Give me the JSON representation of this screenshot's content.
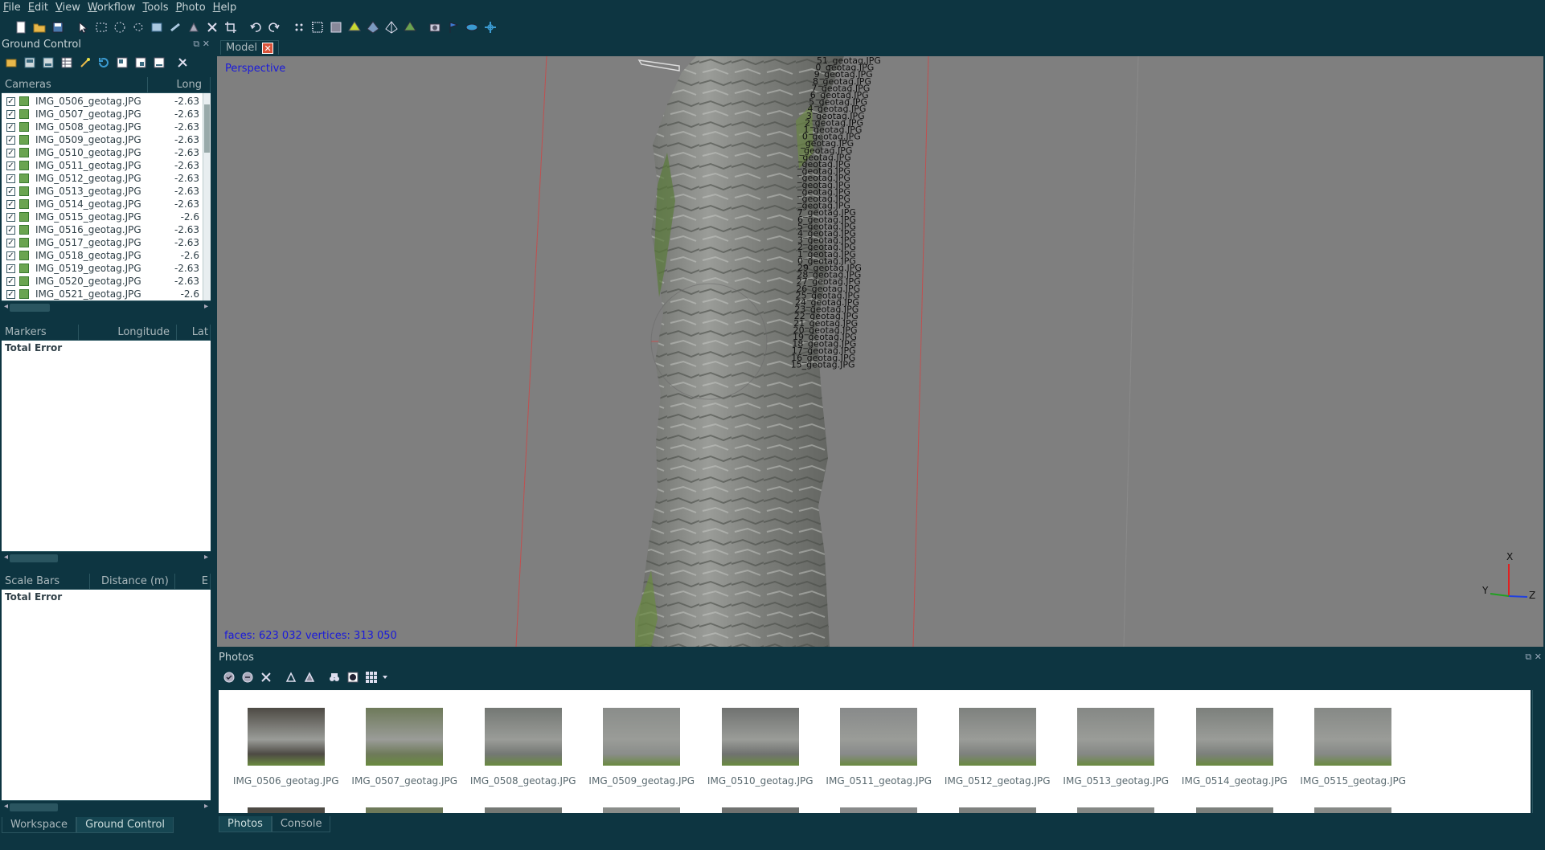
{
  "menu": [
    "File",
    "Edit",
    "View",
    "Workflow",
    "Tools",
    "Photo",
    "Help"
  ],
  "toolbar_icons": [
    "new-icon",
    "open-icon",
    "save-icon",
    "pointer-icon",
    "rect-select-icon",
    "circle-select-icon",
    "free-select-icon",
    "move-region-icon",
    "rotate-region-icon",
    "resize-region-icon",
    "delete-selection-icon",
    "crop-icon",
    "undo-icon",
    "redo-icon",
    "point-cloud-icon",
    "dense-cloud-icon",
    "tiled-icon",
    "shaded-icon",
    "solid-icon",
    "wireframe-icon",
    "textured-icon",
    "show-cameras-icon",
    "show-markers-icon",
    "show-shapes-icon",
    "navigation-icon"
  ],
  "left": {
    "title": "Ground Control",
    "cameras": {
      "headers": [
        "Cameras",
        "Long"
      ],
      "rows": [
        {
          "name": "IMG_0506_geotag.JPG",
          "lon": "-2.63"
        },
        {
          "name": "IMG_0507_geotag.JPG",
          "lon": "-2.63"
        },
        {
          "name": "IMG_0508_geotag.JPG",
          "lon": "-2.63"
        },
        {
          "name": "IMG_0509_geotag.JPG",
          "lon": "-2.63"
        },
        {
          "name": "IMG_0510_geotag.JPG",
          "lon": "-2.63"
        },
        {
          "name": "IMG_0511_geotag.JPG",
          "lon": "-2.63"
        },
        {
          "name": "IMG_0512_geotag.JPG",
          "lon": "-2.63"
        },
        {
          "name": "IMG_0513_geotag.JPG",
          "lon": "-2.63"
        },
        {
          "name": "IMG_0514_geotag.JPG",
          "lon": "-2.63"
        },
        {
          "name": "IMG_0515_geotag.JPG",
          "lon": "-2.6"
        },
        {
          "name": "IMG_0516_geotag.JPG",
          "lon": "-2.63"
        },
        {
          "name": "IMG_0517_geotag.JPG",
          "lon": "-2.63"
        },
        {
          "name": "IMG_0518_geotag.JPG",
          "lon": "-2.6"
        },
        {
          "name": "IMG_0519_geotag.JPG",
          "lon": "-2.63"
        },
        {
          "name": "IMG_0520_geotag.JPG",
          "lon": "-2.63"
        },
        {
          "name": "IMG_0521_geotag.JPG",
          "lon": "-2.6"
        }
      ]
    },
    "markers": {
      "headers": [
        "Markers",
        "Longitude",
        "Lat"
      ],
      "total": "Total Error"
    },
    "scalebars": {
      "headers": [
        "Scale Bars",
        "Distance (m)",
        "E"
      ],
      "total": "Total Error"
    },
    "tabs": [
      "Workspace",
      "Ground Control"
    ]
  },
  "model": {
    "tab": "Model",
    "view_mode": "Perspective",
    "stats": "faces: 623 032 vertices: 313 050",
    "axes": {
      "x": "X",
      "y": "Y",
      "z": "Z"
    },
    "overlay_labels": [
      "51_geotag.JPG",
      "0_geotag.JPG",
      "9_geotag.JPG",
      "8_geotag.JPG",
      "7_geotag.JPG",
      "6_geotag.JPG",
      "5_geotag.JPG",
      "4_geotag.JPG",
      "3_geotag.JPG",
      "2_geotag.JPG",
      "1_geotag.JPG",
      "0_geotag.JPG",
      "_geotag.JPG",
      "_geotag.JPG",
      "_geotag.JPG",
      "_geotag.JPG",
      "_geotag.JPG",
      "_geotag.JPG",
      "_geotag.JPG",
      "_geotag.JPG",
      "_geotag.JPG",
      "_geotag.JPG",
      "7_geotag.JPG",
      "6_geotag.JPG",
      "5_geotag.JPG",
      "4_geotag.JPG",
      "3_geotag.JPG",
      "2_geotag.JPG",
      "1_geotag.JPG",
      "0_geotag.JPG",
      "29_geotag.JPG",
      "28_geotag.JPG",
      "27_geotag.JPG",
      "26_geotag.JPG",
      "25_geotag.JPG",
      "24_geotag.JPG",
      "23_geotag.JPG",
      "22_geotag.JPG",
      "21_geotag.JPG",
      "20_geotag.JPG",
      "19_geotag.JPG",
      "18_geotag.JPG",
      "17_geotag.JPG",
      "16_geotag.JPG",
      "15_geotag.JPG"
    ]
  },
  "photos": {
    "title": "Photos",
    "toolbar_icons": [
      "enable-icon",
      "disable-icon",
      "remove-icon",
      "rotate-right-icon",
      "rotate-left-icon",
      "binoculars-icon",
      "mask-icon",
      "view-mode-icon"
    ],
    "items": [
      {
        "label": "IMG_0506_geotag.JPG",
        "color": "#4d4a44"
      },
      {
        "label": "IMG_0507_geotag.JPG",
        "color": "#6e7a5a"
      },
      {
        "label": "IMG_0508_geotag.JPG",
        "color": "#747874"
      },
      {
        "label": "IMG_0509_geotag.JPG",
        "color": "#8a8d8a"
      },
      {
        "label": "IMG_0510_geotag.JPG",
        "color": "#707270"
      },
      {
        "label": "IMG_0511_geotag.JPG",
        "color": "#888a8a"
      },
      {
        "label": "IMG_0512_geotag.JPG",
        "color": "#7e817e"
      },
      {
        "label": "IMG_0513_geotag.JPG",
        "color": "#858885"
      },
      {
        "label": "IMG_0514_geotag.JPG",
        "color": "#7c807c"
      },
      {
        "label": "IMG_0515_geotag.JPG",
        "color": "#868986"
      }
    ],
    "tabs": [
      "Photos",
      "Console"
    ]
  }
}
